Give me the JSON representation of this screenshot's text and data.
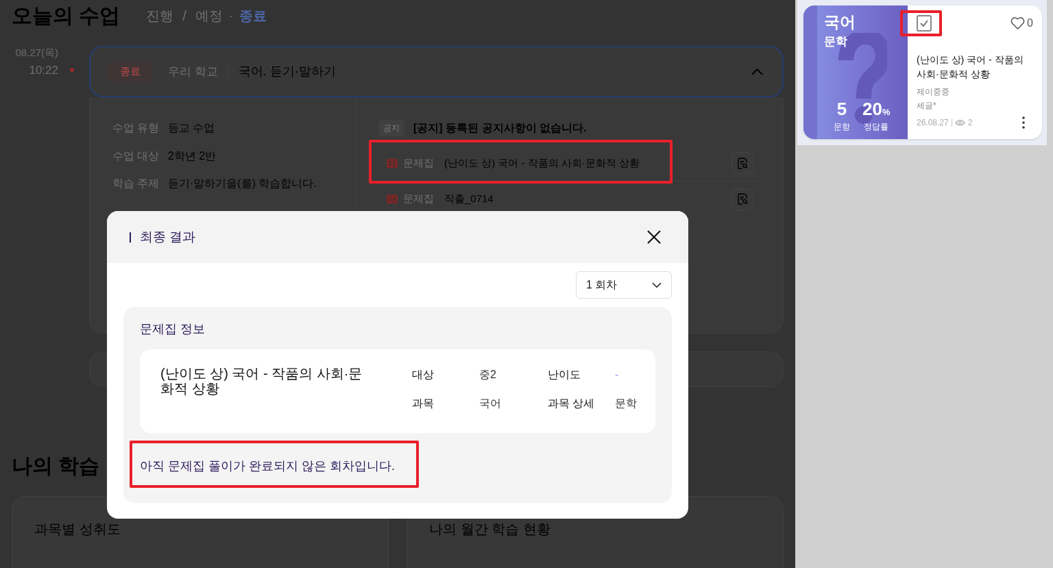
{
  "page": {
    "title": "오늘의 수업",
    "filters": [
      {
        "label": "진행",
        "selected": false
      },
      {
        "label": "예정",
        "selected": false
      },
      {
        "label": "종료",
        "selected": true
      }
    ],
    "filter_separators": [
      "/",
      "·"
    ],
    "lesson": {
      "date": "08.27(목)",
      "time": "10:22",
      "status": "종료",
      "school": "우리 학교",
      "title": "국어. 듣기·말하기",
      "expanded": true,
      "details": [
        {
          "label": "수업 유형",
          "value": "등교 수업"
        },
        {
          "label": "수업 대상",
          "value": "2학년 2반"
        },
        {
          "label": "학습 주제",
          "value": "듣기·말하기을(를) 학습합니다."
        }
      ],
      "notice": {
        "badge": "공지",
        "text": "[공지] 등록된 공지사항이 없습니다."
      },
      "materials": [
        {
          "type": "문제집",
          "title": "(난이도 상) 국어 - 작품의 사회·문화적 상황",
          "highlighted": true
        },
        {
          "type": "문제집",
          "title": "직출_0714",
          "highlighted": false
        }
      ]
    },
    "my_learning": {
      "title": "나의 학습",
      "panels": [
        {
          "title": "과목별 성취도"
        },
        {
          "title": "나의 월간 학습 현황"
        }
      ]
    }
  },
  "modal": {
    "title": "최종 결과",
    "round_select": {
      "value": "1 회차"
    },
    "section_title": "문제집 정보",
    "workbook": {
      "title": "(난이도 상) 국어 - 작품의 사회·문화적 상황",
      "fields": [
        {
          "label": "대상",
          "value": "중2",
          "empty": false
        },
        {
          "label": "난이도",
          "value": "-",
          "empty": true
        },
        {
          "label": "과목",
          "value": "국어",
          "empty": false
        },
        {
          "label": "과목 상세",
          "value": "문학",
          "empty": false
        }
      ]
    },
    "message": {
      "text": "아직 문제집 풀이가 완료되지 않은 회차입니다.",
      "highlighted": true
    }
  },
  "card": {
    "subject": "국어",
    "category": "문학",
    "stats": [
      {
        "value": "5",
        "label": "문항"
      },
      {
        "value": "20",
        "unit": "%",
        "label": "정답률"
      }
    ],
    "checkbox": {
      "checked": true,
      "highlighted": true
    },
    "likes": "0",
    "title": "(난이도 상) 국어 - 작품의 사회·문화적 상황",
    "author": "제이중중",
    "tag": "세글*",
    "date": "26.08.27",
    "views": "2"
  }
}
